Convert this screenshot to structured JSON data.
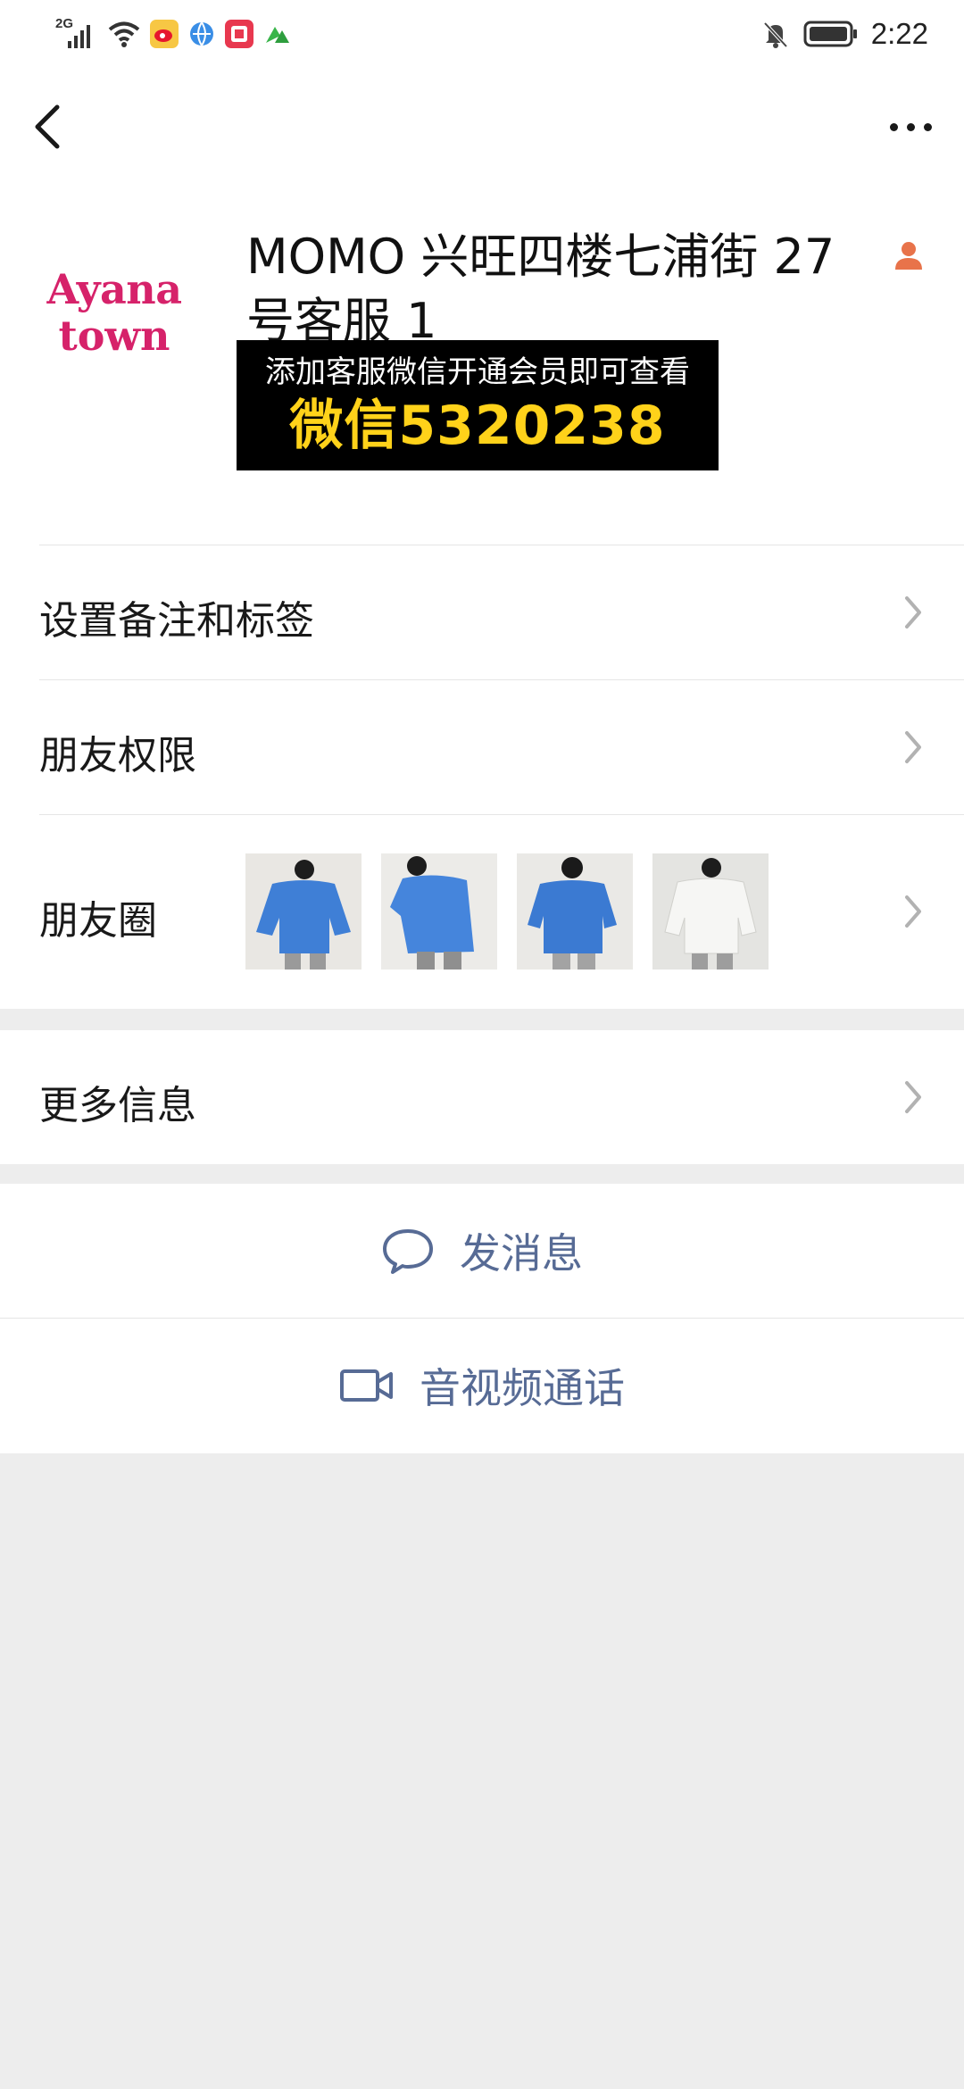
{
  "status_bar": {
    "network": "2G",
    "time": "2:22",
    "icons": [
      "signal-icon",
      "wifi-icon",
      "weibo-app-icon",
      "browser-app-icon",
      "red-app-icon",
      "green-app-icon",
      "bell-muted-icon",
      "battery-icon"
    ]
  },
  "nav": {
    "back_icon": "chevron-left-icon",
    "more_icon": "more-dots-icon"
  },
  "profile": {
    "avatar_line1": "Ayana",
    "avatar_line2": "town",
    "name": "MOMO 兴旺四楼七浦街 27 号客服 1",
    "badge_icon": "person-icon",
    "overlay_line1": "添加客服微信开通会员即可查看",
    "overlay_line2": "微信5320238"
  },
  "rows": {
    "remark": "设置备注和标签",
    "permissions": "朋友权限",
    "moments": "朋友圈",
    "more_info": "更多信息"
  },
  "moments_thumbnails": [
    {
      "desc": "blue-sweater-front",
      "color": "#3f7fd6"
    },
    {
      "desc": "blue-sweater-side",
      "color": "#4585dc"
    },
    {
      "desc": "blue-sweater-back",
      "color": "#3b7ad2"
    },
    {
      "desc": "white-sweater",
      "color": "#eeeeee"
    }
  ],
  "actions": {
    "message": "发消息",
    "video_call": "音视频通话"
  },
  "colors": {
    "link_blue": "#576b95",
    "page_bg": "#ededed",
    "overlay_yellow": "#ffd21a",
    "avatar_pink": "#d6226a"
  }
}
